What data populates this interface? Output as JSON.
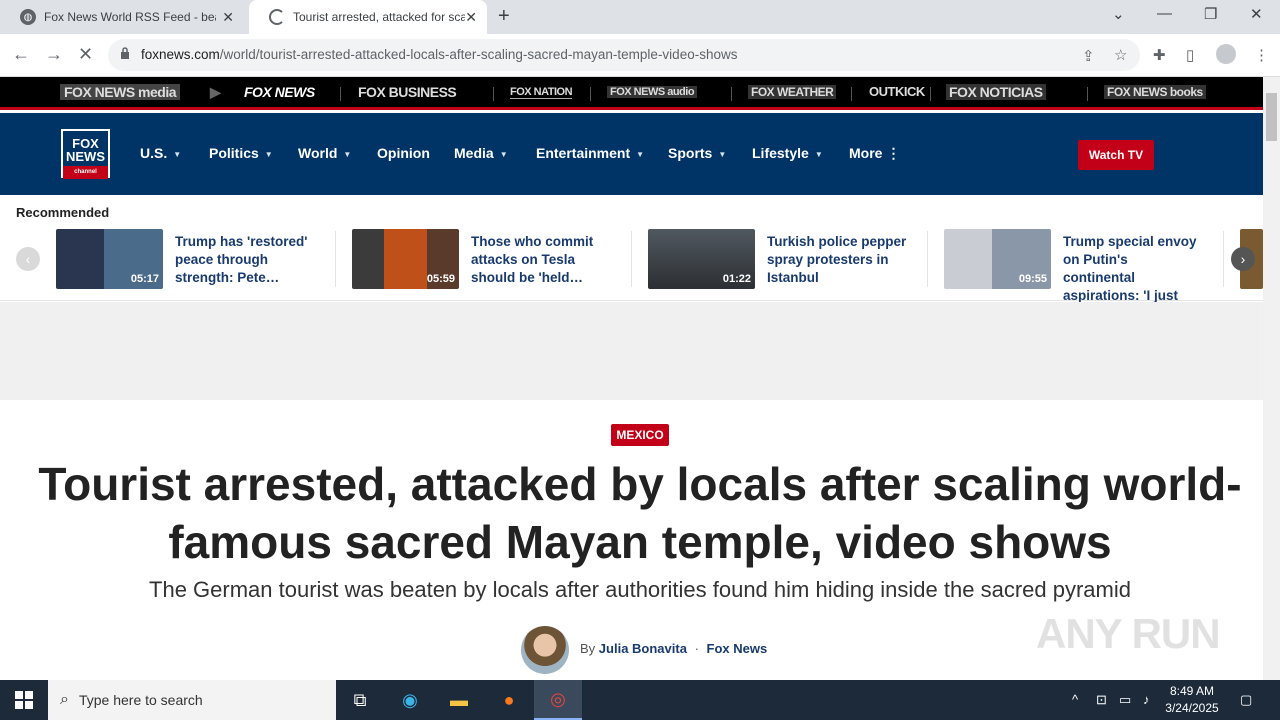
{
  "browser": {
    "tabs": [
      {
        "title": "Fox News World RSS Feed - bea",
        "close": "✕"
      },
      {
        "title": "Tourist arrested, attacked for sca",
        "close": "✕"
      }
    ],
    "new_tab": "+",
    "window": {
      "minimize": "—",
      "restore": "❐",
      "close": "✕",
      "tab_search": "⌄"
    },
    "nav": {
      "back": "←",
      "forward": "→",
      "reload": "✕"
    },
    "url_domain": "foxnews.com",
    "url_path": "/world/tourist-arrested-attacked-locals-after-scaling-sacred-mayan-temple-video-shows"
  },
  "brand_bar": [
    "FOX NEWS media",
    "FOX NEWS",
    "FOX BUSINESS",
    "FOX NATION",
    "FOX NEWS audio",
    "FOX WEATHER",
    "OUTKICK",
    "FOX NOTICIAS",
    "FOX NEWS books"
  ],
  "logo": {
    "line1": "FOX",
    "line2": "NEWS",
    "line3": "channel"
  },
  "nav": {
    "items": [
      "U.S.",
      "Politics",
      "World",
      "Opinion",
      "Media",
      "Entertainment",
      "Sports",
      "Lifestyle",
      "More"
    ],
    "watch_tv": "Watch TV"
  },
  "recommended": {
    "title": "Recommended",
    "cards": [
      {
        "text": "Trump has 'restored' peace through strength: Pete…",
        "duration": "05:17"
      },
      {
        "text": "Those who commit attacks on Tesla should be 'held…",
        "duration": "05:59"
      },
      {
        "text": "Turkish police pepper spray protesters in Istanbul",
        "duration": "01:22"
      },
      {
        "text": "Trump special envoy on Putin's continental aspirations: 'I just do…",
        "duration": "09:55"
      }
    ]
  },
  "article": {
    "kicker": "MEXICO",
    "headline": "Tourist arrested, attacked by locals after scaling world-famous sacred Mayan temple, video shows",
    "subhead": "The German tourist was beaten by locals after authorities found him hiding inside the sacred pyramid",
    "by": "By",
    "author": "Julia Bonavita",
    "separator": "·",
    "outlet": "Fox News"
  },
  "watermark": "ANY RUN",
  "taskbar": {
    "search_placeholder": "Type here to search",
    "time": "8:49 AM",
    "date": "3/24/2025"
  },
  "colors": {
    "fox_navy": "#003366",
    "fox_red": "#c20017"
  }
}
